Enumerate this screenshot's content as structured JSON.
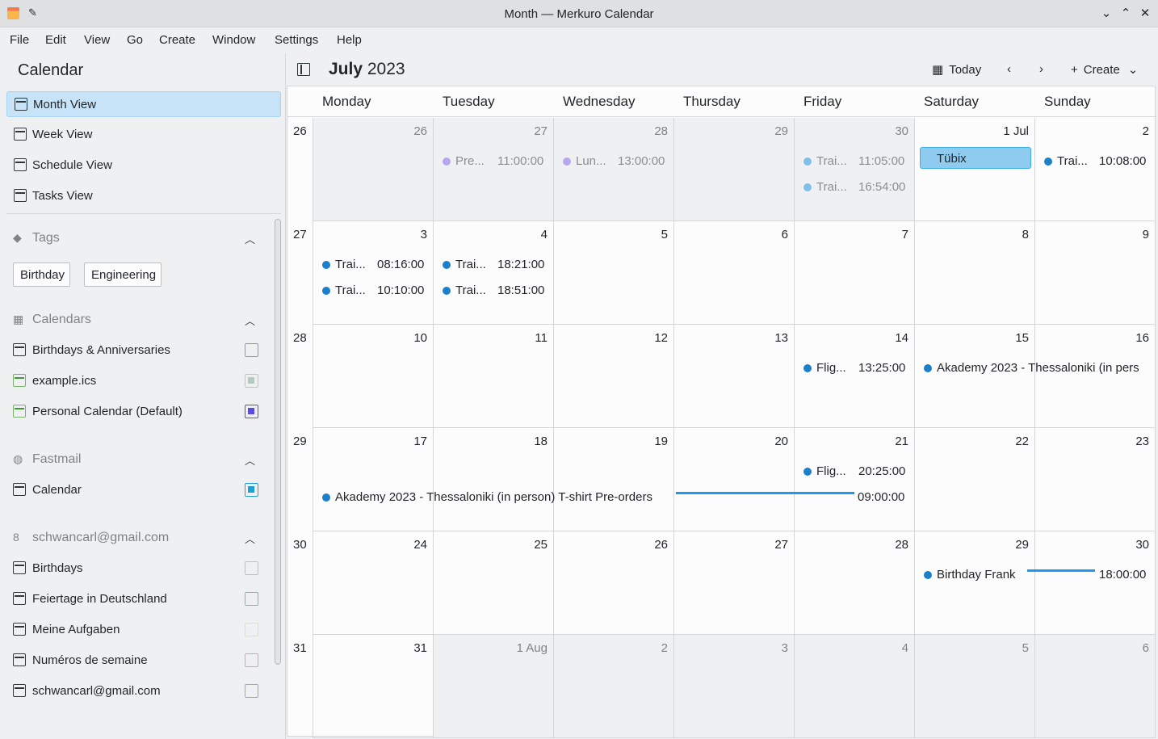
{
  "window": {
    "title": "Month — Merkuro Calendar"
  },
  "menu": [
    "File",
    "Edit",
    "View",
    "Go",
    "Create",
    "Window",
    "Settings",
    "Help"
  ],
  "sidebar": {
    "title": "Calendar",
    "views": [
      "Month View",
      "Week View",
      "Schedule View",
      "Tasks View"
    ],
    "tags_title": "Tags",
    "tags": [
      "Birthday",
      "Engineering"
    ],
    "calendars_title": "Calendars",
    "local_calendars": [
      {
        "name": "Birthdays & Anniversaries",
        "color": "#8c8cf5"
      },
      {
        "name": "example.ics",
        "color": "#b7c9c0"
      },
      {
        "name": "Personal Calendar (Default)",
        "color": "#5b4ae6"
      }
    ],
    "fastmail_title": "Fastmail",
    "fastmail_calendars": [
      {
        "name": "Calendar",
        "color": "#1ba1d6"
      }
    ],
    "gmail_title": "schwancarl@gmail.com",
    "gmail_calendars": [
      {
        "name": "Birthdays",
        "color": "#9fd89a"
      },
      {
        "name": "Feiertage in Deutschland",
        "color": "#6fc1a3"
      },
      {
        "name": "Meine Aufgaben",
        "color": "#efe67a"
      },
      {
        "name": "Numéros de semaine",
        "color": "#f29c86"
      },
      {
        "name": "schwancarl@gmail.com",
        "color": "#8ba9e8"
      }
    ]
  },
  "toolbar": {
    "month_bold": "July",
    "year": "2023",
    "today": "Today",
    "create": "Create"
  },
  "days": [
    "Monday",
    "Tuesday",
    "Wednesday",
    "Thursday",
    "Friday",
    "Saturday",
    "Sunday"
  ],
  "weeks": [
    {
      "wk": "26",
      "dates": [
        "26",
        "27",
        "28",
        "29",
        "30",
        "1 Jul",
        "2"
      ]
    },
    {
      "wk": "27",
      "dates": [
        "3",
        "4",
        "5",
        "6",
        "7",
        "8",
        "9"
      ]
    },
    {
      "wk": "28",
      "dates": [
        "10",
        "11",
        "12",
        "13",
        "14",
        "15",
        "16"
      ]
    },
    {
      "wk": "29",
      "dates": [
        "17",
        "18",
        "19",
        "20",
        "21",
        "22",
        "23"
      ]
    },
    {
      "wk": "30",
      "dates": [
        "24",
        "25",
        "26",
        "27",
        "28",
        "29",
        "30"
      ]
    },
    {
      "wk": "31",
      "dates": [
        "31",
        "1 Aug",
        "2",
        "3",
        "4",
        "5",
        "6"
      ]
    }
  ],
  "events": {
    "e1": {
      "title": "Pre...",
      "time": "11:00:00"
    },
    "e2": {
      "title": "Lun...",
      "time": "13:00:00"
    },
    "e3": {
      "title": "Trai...",
      "time": "11:05:00"
    },
    "e4": {
      "title": "Trai...",
      "time": "16:54:00"
    },
    "e5": {
      "title": "Tübix"
    },
    "e6": {
      "title": "Trai...",
      "time": "10:08:00"
    },
    "e7": {
      "title": "Trai...",
      "time": "08:16:00"
    },
    "e8": {
      "title": "Trai...",
      "time": "10:10:00"
    },
    "e9": {
      "title": "Trai...",
      "time": "18:21:00"
    },
    "e10": {
      "title": "Trai...",
      "time": "18:51:00"
    },
    "e11": {
      "title": "Flig...",
      "time": "13:25:00"
    },
    "e12": {
      "title": "Akademy 2023 - Thessaloniki (in pers"
    },
    "e13": {
      "title": "Flig...",
      "time": "20:25:00"
    },
    "e14": {
      "title": "Akademy 2023 - Thessaloniki (in person) T-shirt Pre-orders",
      "time": "09:00:00"
    },
    "e15": {
      "title": "Birthday Frank",
      "time": "18:00:00"
    }
  }
}
